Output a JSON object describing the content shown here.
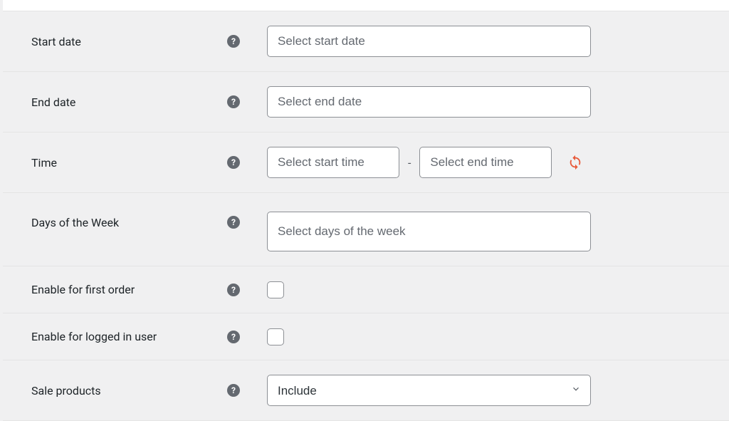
{
  "rows": {
    "start_date": {
      "label": "Start date",
      "placeholder": "Select start date"
    },
    "end_date": {
      "label": "End date",
      "placeholder": "Select end date"
    },
    "time": {
      "label": "Time",
      "start_placeholder": "Select start time",
      "end_placeholder": "Select end time",
      "dash": "-"
    },
    "days": {
      "label": "Days of the Week",
      "placeholder": "Select days of the week"
    },
    "first_order": {
      "label": "Enable for first order"
    },
    "logged_in": {
      "label": "Enable for logged in user"
    },
    "sale_products": {
      "label": "Sale products",
      "selected": "Include"
    }
  },
  "help_glyph": "?"
}
